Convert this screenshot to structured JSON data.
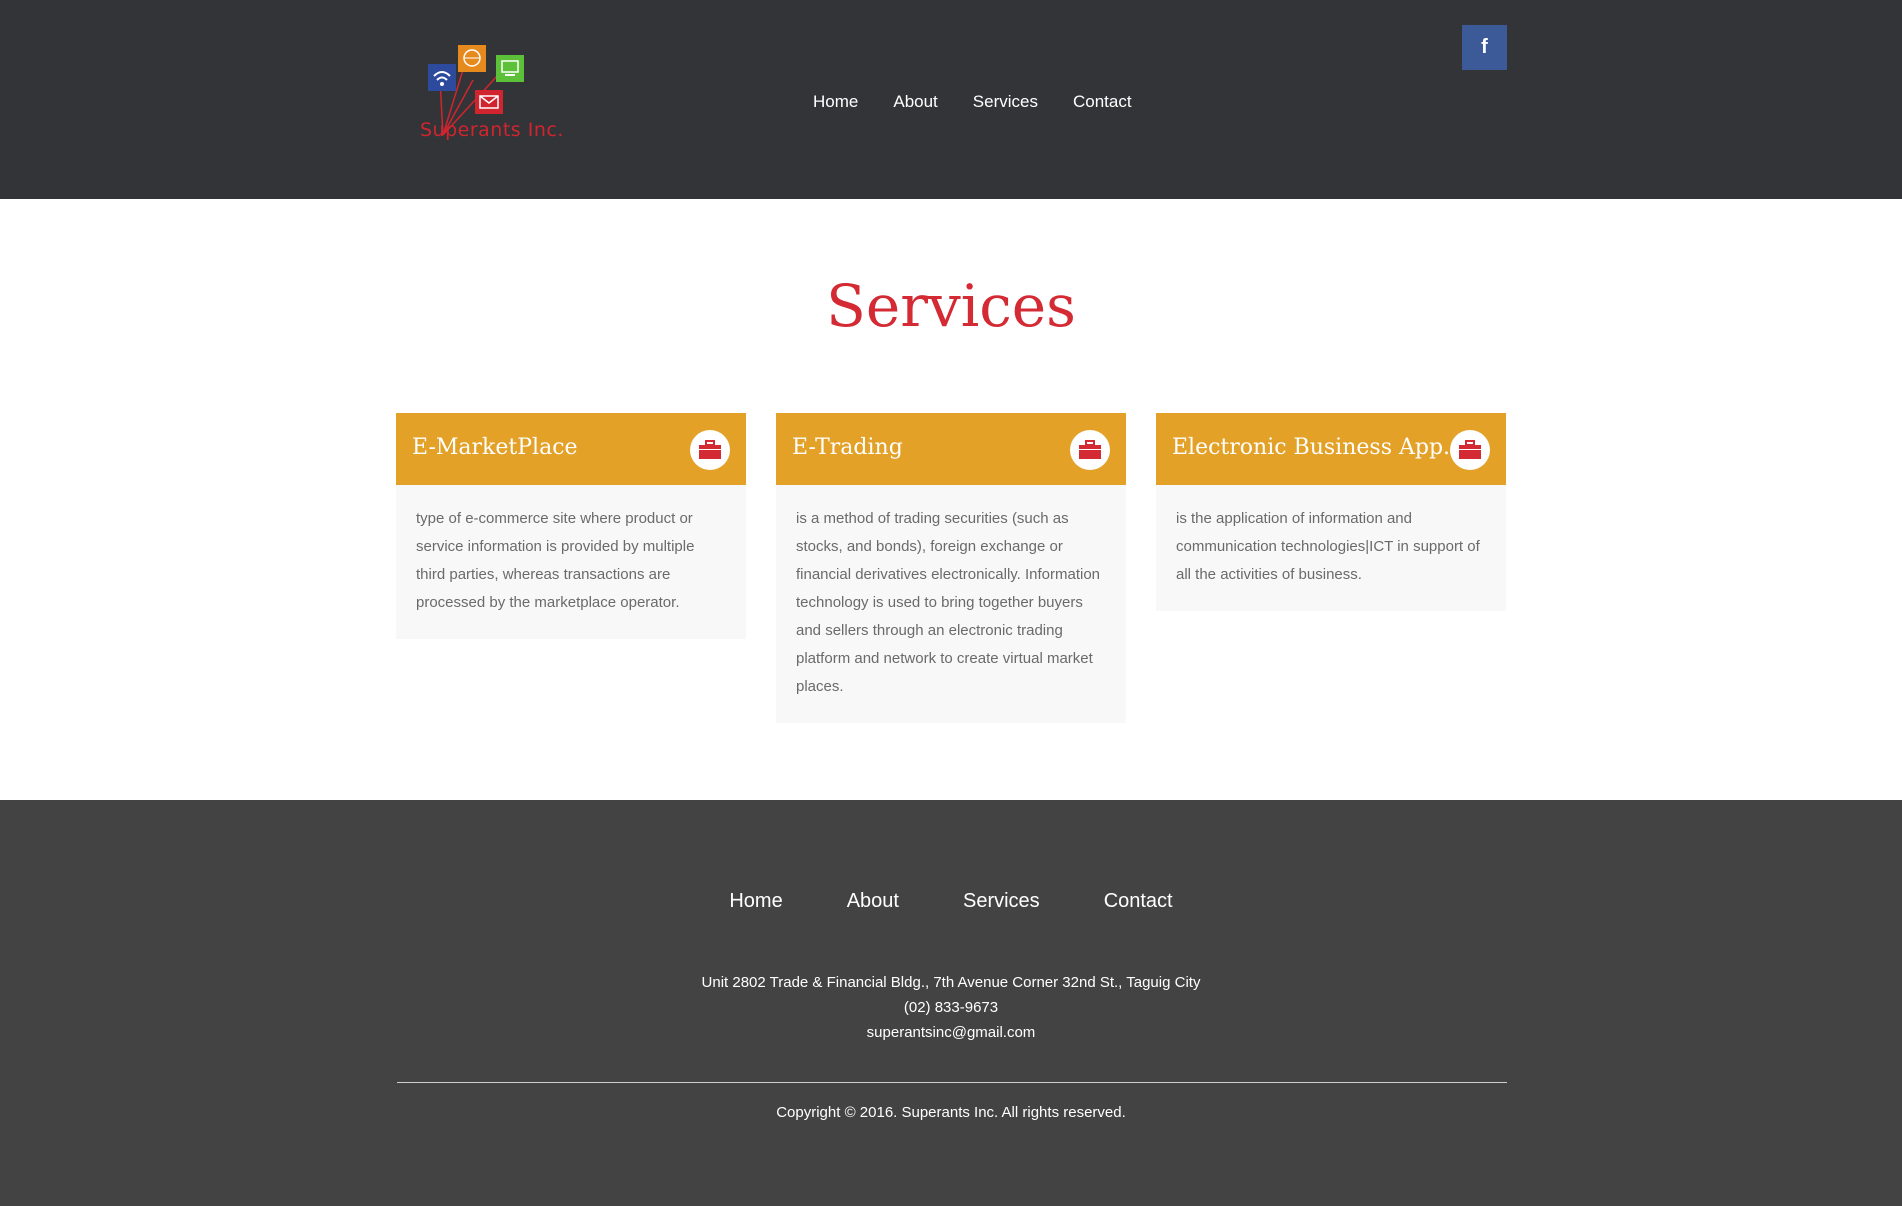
{
  "header": {
    "logo_text": "Superants Inc.",
    "nav": [
      "Home",
      "About",
      "Services",
      "Contact"
    ],
    "facebook_label": "f"
  },
  "page_title": "Services",
  "cards": [
    {
      "title": "E-MarketPlace",
      "icon": "briefcase-icon",
      "text": "type of e-commerce site where product or service information is provided by multiple third parties, whereas transactions are processed by the marketplace operator."
    },
    {
      "title": "E-Trading",
      "icon": "briefcase-icon",
      "text": "is a method of trading securities (such as stocks, and bonds), foreign exchange or financial derivatives electronically. Information technology is used to bring together buyers and sellers through an electronic trading platform and network to create virtual market places."
    },
    {
      "title": "Electronic Business App.",
      "icon": "briefcase-icon",
      "text": "is the application of information and communication technologies|ICT in support of all the activities of business."
    }
  ],
  "footer": {
    "nav": [
      "Home",
      "About",
      "Services",
      "Contact"
    ],
    "address": "Unit 2802 Trade & Financial Bldg., 7th Avenue Corner 32nd St., Taguig City",
    "phone": "(02) 833-9673",
    "email": "superantsinc@gmail.com",
    "copyright": "Copyright © 2016. Superants Inc. All rights reserved."
  },
  "colors": {
    "header_bg": "#333437",
    "accent_red": "#d32a34",
    "card_orange": "#e3a127",
    "footer_bg": "#434343",
    "facebook_blue": "#3d5a98"
  }
}
